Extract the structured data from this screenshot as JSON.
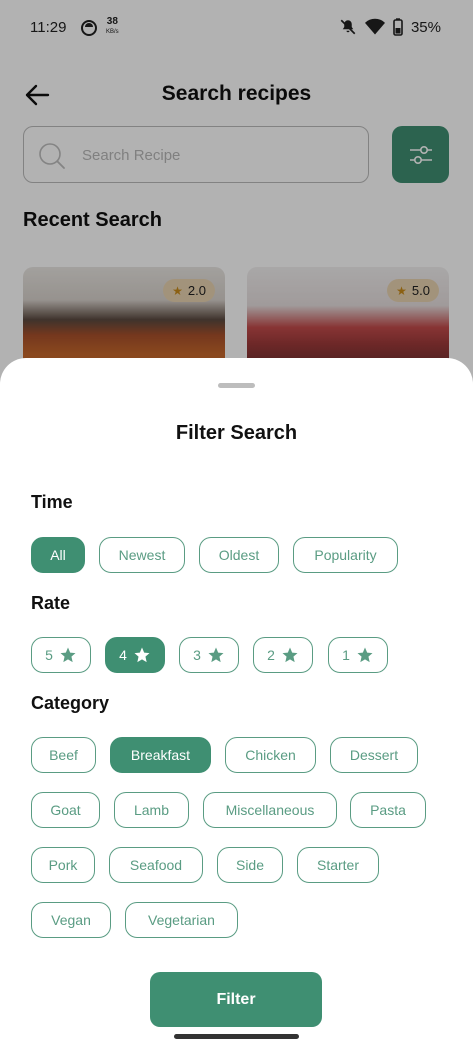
{
  "status_bar": {
    "time": "11:29",
    "speed_value": "38",
    "speed_unit": "KB/s",
    "battery": "35%"
  },
  "header": {
    "title": "Search recipes"
  },
  "search": {
    "placeholder": "Search Recipe"
  },
  "recent": {
    "title": "Recent Search",
    "cards": [
      {
        "rating": "2.0"
      },
      {
        "rating": "5.0"
      }
    ]
  },
  "sheet": {
    "title": "Filter Search",
    "time": {
      "label": "Time",
      "options": [
        "All",
        "Newest",
        "Oldest",
        "Popularity"
      ],
      "selected": "All"
    },
    "rate": {
      "label": "Rate",
      "options": [
        "5",
        "4",
        "3",
        "2",
        "1"
      ],
      "selected": "4"
    },
    "category": {
      "label": "Category",
      "options": [
        "Beef",
        "Breakfast",
        "Chicken",
        "Dessert",
        "Goat",
        "Lamb",
        "Miscellaneous",
        "Pasta",
        "Pork",
        "Seafood",
        "Side",
        "Starter",
        "Vegan",
        "Vegetarian"
      ],
      "selected": "Breakfast"
    },
    "submit_label": "Filter"
  },
  "colors": {
    "primary": "#3f8f72",
    "chip_outline": "#5a9c83",
    "rating_badge": "#e9d3b1"
  },
  "icons": [
    "back-arrow-icon",
    "search-icon",
    "sliders-icon",
    "star-icon",
    "mute-icon",
    "wifi-icon",
    "battery-icon"
  ]
}
